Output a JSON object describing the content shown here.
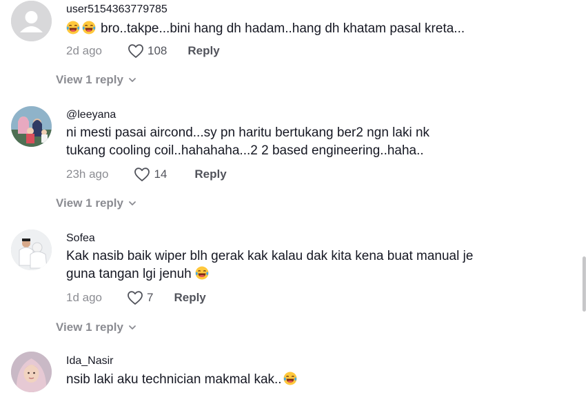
{
  "comments": [
    {
      "username": "user5154363779785",
      "avatar": "default-avatar-icon",
      "lines": [
        "bro..takpe...bini hang dh hadam..hang dh khatam pasal kreta..."
      ],
      "lead_emojis": [
        "laughing-tears-emoji",
        "laughing-tears-emoji"
      ],
      "time": "2d ago",
      "likes": "108",
      "reply_label": "Reply",
      "view_replies": "View 1 reply"
    },
    {
      "username": "@leeyana",
      "avatar": "family-photo-avatar",
      "lines": [
        "ni mesti pasai aircond...sy pn haritu bertukang ber2 ngn laki nk",
        "tukang cooling coil..hahahaha...2 2 based engineering..haha.."
      ],
      "time": "23h ago",
      "likes": "14",
      "reply_label": "Reply",
      "view_replies": "View 1 reply"
    },
    {
      "username": "Sofea",
      "avatar": "couple-photo-avatar",
      "lines": [
        "Kak nasib baik wiper blh gerak kak kalau dak kita kena buat manual je",
        "guna tangan lgi jenuh"
      ],
      "trail_emoji": "laughing-tears-emoji",
      "time": "1d ago",
      "likes": "7",
      "reply_label": "Reply",
      "view_replies": "View 1 reply"
    },
    {
      "username": "Ida_Nasir",
      "avatar": "hijab-photo-avatar",
      "lines": [
        "nsib laki aku technician makmal kak.."
      ],
      "trail_emoji": "laughing-tears-emoji"
    }
  ],
  "colors": {
    "text": "#161823",
    "muted": "#8a8b91",
    "avatar_bg": "#d8d8da"
  }
}
